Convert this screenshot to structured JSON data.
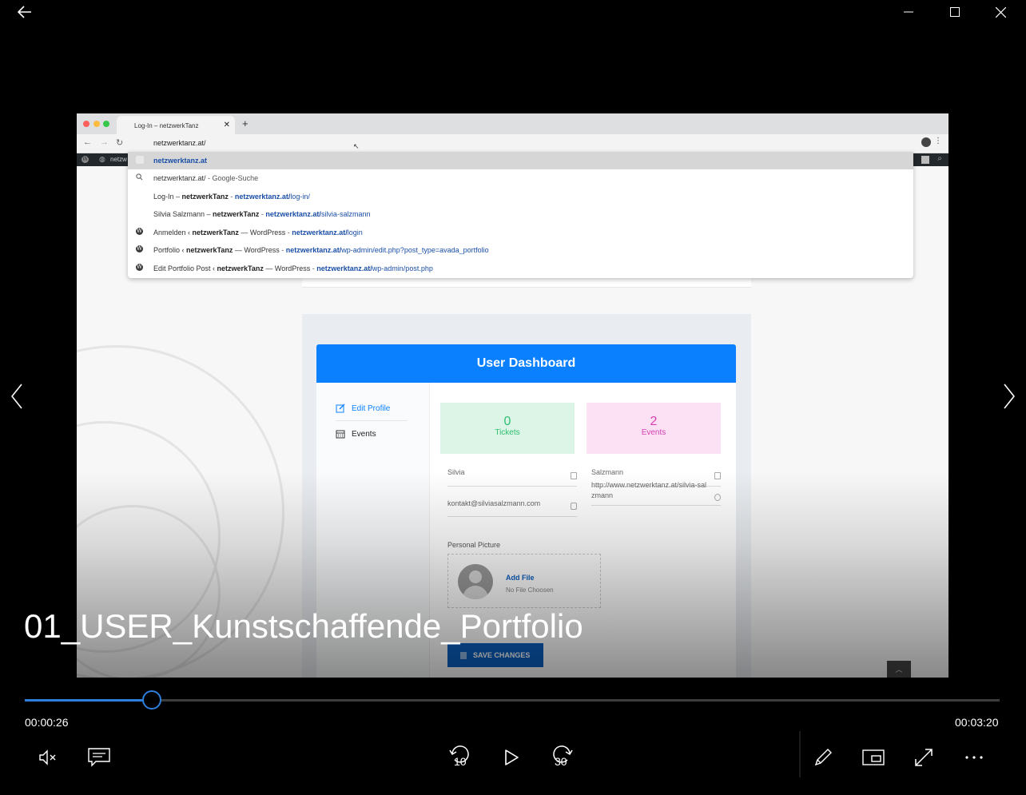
{
  "window": {
    "back_icon": "arrow-left-icon",
    "minimize_icon": "minimize-icon",
    "maximize_icon": "maximize-icon",
    "close_icon": "close-icon"
  },
  "browser": {
    "tab_title": "Log-In – netzwerkTanz",
    "address_text": "netzwerktanz.at/",
    "wp_bar_label": "netzw",
    "suggestions": [
      {
        "kind": "page",
        "selected": true,
        "bold": "netzwerktanz.at"
      },
      {
        "kind": "search",
        "plain": "netzwerktanz.at/",
        "suffix": "- Google-Suche"
      },
      {
        "kind": "page",
        "pre": "Log-In – ",
        "bold": "netzwerkTanz",
        "sep": " - ",
        "url_bold": "netzwerktanz.at/",
        "url_rest": "log-in/"
      },
      {
        "kind": "page",
        "pre": "Silvia Salzmann – ",
        "bold": "netzwerkTanz",
        "sep": " - ",
        "url_bold": "netzwerktanz.at/",
        "url_rest": "silvia-salzmann"
      },
      {
        "kind": "wp",
        "pre": "Anmelden ‹ ",
        "bold": "netzwerkTanz",
        "post": " — WordPress",
        "sep": " - ",
        "url_bold": "netzwerktanz.at/",
        "url_rest": "login"
      },
      {
        "kind": "wp",
        "pre": "Portfolio ‹ ",
        "bold": "netzwerkTanz",
        "post": " — WordPress",
        "sep": " - ",
        "url_bold": "netzwerktanz.at/",
        "url_rest": "wp-admin/edit.php?post_type=avada_portfolio"
      },
      {
        "kind": "wp",
        "pre": "Edit Portfolio Post ‹ ",
        "bold": "netzwerkTanz",
        "post": " — WordPress",
        "sep": " - ",
        "url_bold": "netzwerktanz.at/",
        "url_rest": "wp-admin/post.php"
      }
    ]
  },
  "dashboard": {
    "title": "User Dashboard",
    "menu": {
      "edit_profile": "Edit Profile",
      "events": "Events"
    },
    "cards": {
      "tickets_count": "0",
      "tickets_label": "Tickets",
      "events_count": "2",
      "events_label": "Events"
    },
    "fields": {
      "first_name": "Silvia",
      "last_name": "Salzmann",
      "email": "kontakt@silviasalzmann.com",
      "website": "http://www.netzwerktanz.at/silvia-salzmann"
    },
    "picture_label": "Personal Picture",
    "add_file": "Add File",
    "no_file": "No File Choosen",
    "save_label": "SAVE CHANGES"
  },
  "player": {
    "title": "01_USER_Kunstschaffende_Portfolio",
    "current_time": "00:00:26",
    "total_time": "00:03:20",
    "progress": 0.13,
    "skip_back_label": "10",
    "skip_forward_label": "30",
    "accent_color": "#2d7fdc"
  }
}
